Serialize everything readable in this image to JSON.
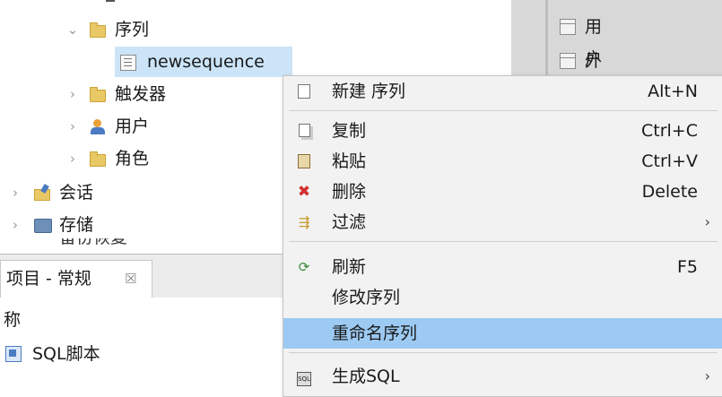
{
  "tree": {
    "sequence_folder": "序列",
    "sequence_item": "newsequence",
    "triggers": "触发器",
    "users": "用户",
    "roles": "角色",
    "sessions": "会话",
    "storage": "存储",
    "partial_cut": "备份恢复"
  },
  "right_panel": {
    "user_table": "用户表",
    "external_table": "外部表"
  },
  "project_panel": {
    "tab_label": "项目 - 常规",
    "tab_close": "☒",
    "column_header": "称",
    "item": "SQL脚本"
  },
  "context_menu": {
    "items": [
      {
        "label": "新建 序列",
        "shortcut": "Alt+N",
        "icon": "new-sequence-icon"
      },
      {
        "label": "复制",
        "shortcut": "Ctrl+C",
        "icon": "copy-icon"
      },
      {
        "label": "粘贴",
        "shortcut": "Ctrl+V",
        "icon": "paste-icon"
      },
      {
        "label": "删除",
        "shortcut": "Delete",
        "icon": "delete-icon"
      },
      {
        "label": "过滤",
        "shortcut": "",
        "icon": "filter-icon",
        "submenu": true
      },
      {
        "label": "刷新",
        "shortcut": "F5",
        "icon": "refresh-icon"
      },
      {
        "label": "修改序列",
        "shortcut": "",
        "icon": ""
      },
      {
        "label": "重命名序列",
        "shortcut": "",
        "icon": "",
        "highlighted": true
      },
      {
        "label": "生成SQL",
        "shortcut": "",
        "icon": "generate-sql-icon",
        "submenu": true
      }
    ],
    "submenu_arrow": "›"
  },
  "colors": {
    "highlight": "#9ccaf3",
    "selected_tree_item": "#cce4f7",
    "menu_background": "#f2f2f2",
    "delete_icon": "#d32f2f"
  }
}
